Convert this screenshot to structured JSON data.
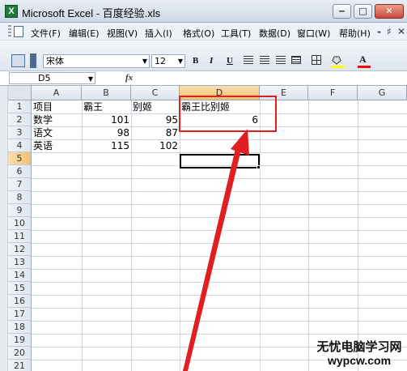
{
  "window": {
    "title": "Microsoft Excel - 百度经验.xls",
    "min": "‒",
    "max": "□",
    "close": "✕",
    "app_icon": "X"
  },
  "menu": {
    "items": [
      "文件(F)",
      "编辑(E)",
      "视图(V)",
      "插入(I)",
      "格式(O)",
      "工具(T)",
      "数据(D)",
      "窗口(W)",
      "帮助(H)"
    ],
    "right_icons": [
      "-",
      "♯",
      "✕"
    ]
  },
  "toolbar": {
    "font_name": "宋体",
    "font_size": "12",
    "bold": "B",
    "italic": "I",
    "underline": "U",
    "font_color_label": "A",
    "fill_color": "#ffff00",
    "font_color": "#ff0000"
  },
  "formula_bar": {
    "name_box": "D5",
    "fx": "fx",
    "formula": ""
  },
  "sheet": {
    "columns": [
      "A",
      "B",
      "C",
      "D",
      "E",
      "F",
      "G"
    ],
    "selected_column": "D",
    "rows": [
      "1",
      "2",
      "3",
      "4",
      "5",
      "6",
      "7",
      "8",
      "9",
      "10",
      "11",
      "12",
      "13",
      "14",
      "15",
      "16",
      "17",
      "18",
      "19",
      "20",
      "21"
    ],
    "selected_row": "5",
    "cells": {
      "A1": "项目",
      "B1": "霸王",
      "C1": "别姬",
      "D1": "霸王比别姬",
      "A2": "数学",
      "B2": "101",
      "C2": "95",
      "D2": "6",
      "A3": "语文",
      "B3": "98",
      "C3": "87",
      "A4": "英语",
      "B4": "115",
      "C4": "102"
    }
  },
  "watermark": {
    "line1": "无忧电脑学习网",
    "line2": "wypcw.com"
  },
  "colors": {
    "highlight": "#e02020",
    "selected_header": "#f0c270"
  }
}
